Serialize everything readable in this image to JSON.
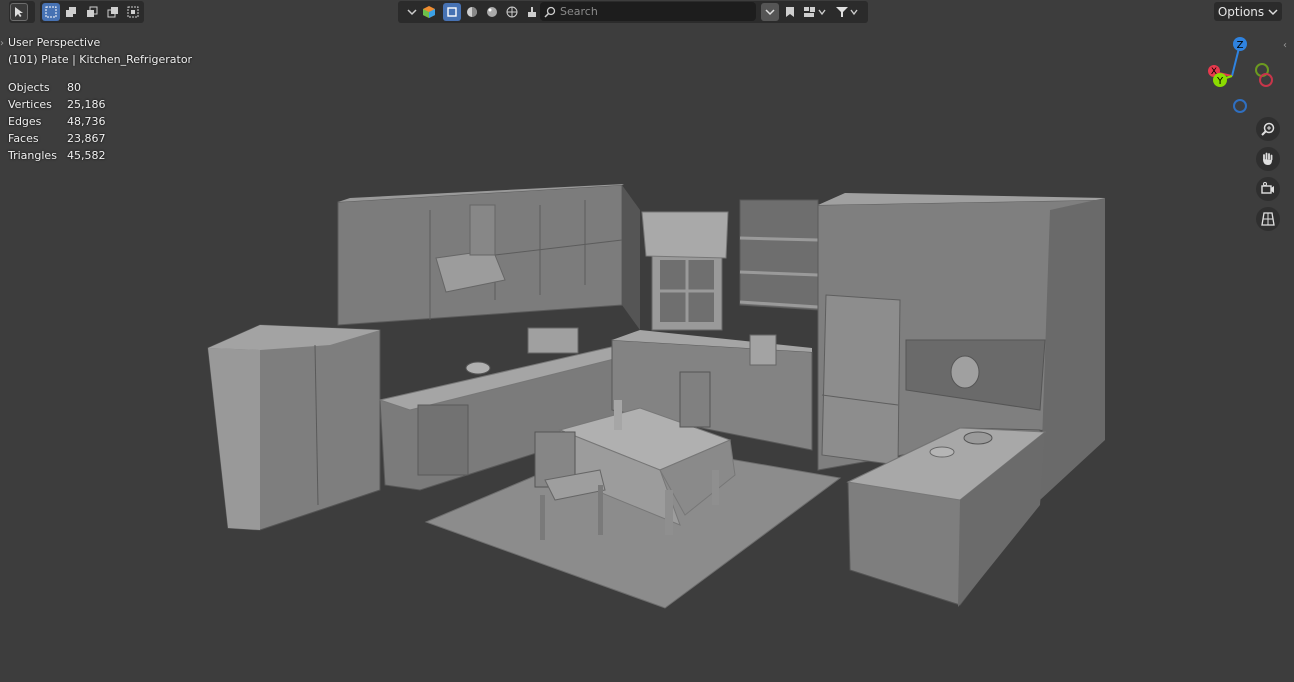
{
  "toolbar": {
    "select_tool_icon": "cursor-select-icon",
    "select_modes": [
      "select-new-icon",
      "select-extend-icon",
      "select-subtract-icon",
      "select-difference-icon",
      "select-intersect-icon"
    ],
    "shading_modes": [
      "wireframe-icon",
      "solid-icon",
      "material-preview-icon",
      "rendered-icon"
    ],
    "search_placeholder": "Search",
    "options_label": "Options"
  },
  "viewport": {
    "perspective_label": "User Perspective",
    "object_label": "(101) Plate | Kitchen_Refrigerator",
    "stats": [
      {
        "label": "Objects",
        "value": "80"
      },
      {
        "label": "Vertices",
        "value": "25,186"
      },
      {
        "label": "Edges",
        "value": "48,736"
      },
      {
        "label": "Faces",
        "value": "23,867"
      },
      {
        "label": "Triangles",
        "value": "45,582"
      }
    ]
  },
  "gizmo": {
    "axes": [
      "Z",
      "Y",
      "X"
    ],
    "colors": {
      "x": "#e8394d",
      "y": "#8bdc00",
      "z": "#2f83e0"
    }
  },
  "colors": {
    "viewport_bg": "#3d3d3d",
    "header_bg": "#2b2b2b",
    "accent": "#4772b3",
    "model": "#8a8a8a"
  }
}
